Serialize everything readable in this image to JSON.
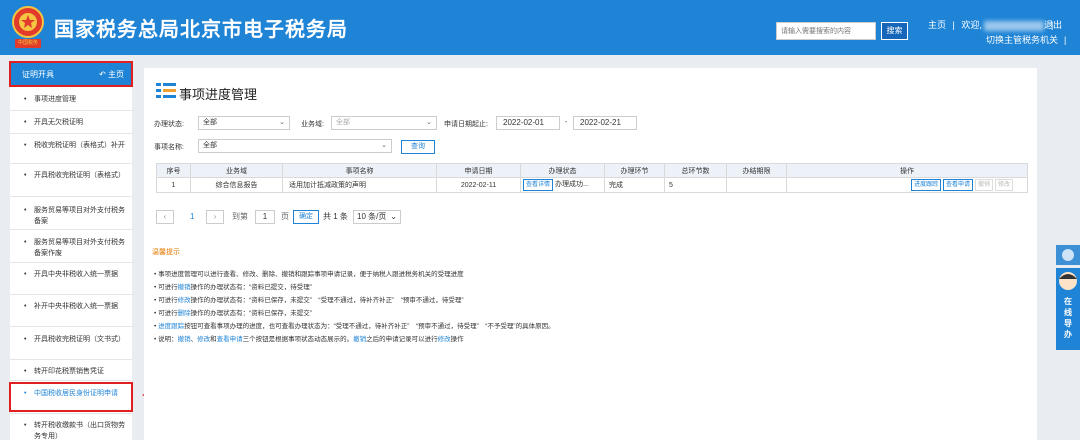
{
  "header": {
    "title": "国家税务总局北京市电子税务局",
    "search_placeholder": "请输入需要搜索的内容",
    "search_label": "搜索",
    "home": "主页",
    "welcome": "欢迎,",
    "switch_org": "切换主管税务机关",
    "logout": "退出",
    "seal_text": "中国税务"
  },
  "sidebar": {
    "head_title": "证明开具",
    "head_home": "主页",
    "items": [
      {
        "label": "事项进度管理"
      },
      {
        "label": "开具无欠税证明"
      },
      {
        "label": "税收完税证明（表格式）补开"
      },
      {
        "label": "开具税收完税证明（表格式）"
      },
      {
        "label": "服务贸易等项目对外支付税务备案"
      },
      {
        "label": "服务贸易等项目对外支付税务备案作废"
      },
      {
        "label": "开具中央非税收入统一票据"
      },
      {
        "label": "补开中央非税收入统一票据"
      },
      {
        "label": "开具税收完税证明（文书式）"
      },
      {
        "label": "转开印花税票销售凭证"
      },
      {
        "label": "中国税收居民身份证明申请"
      },
      {
        "label": "转开税收缴款书（出口货物劳务专用）"
      }
    ]
  },
  "main": {
    "title": "事项进度管理",
    "filters": {
      "status_label": "办理状态:",
      "status_value": "全部",
      "business_label": "业务域:",
      "business_value": "全部",
      "date_label": "申请日期起止:",
      "date_from": "2022-02-01",
      "date_sep": "-",
      "date_to": "2022-02-21",
      "item_label": "事项名称:",
      "item_value": "全部",
      "query": "查询"
    },
    "table": {
      "headers": [
        "序号",
        "业务域",
        "事项名称",
        "申请日期",
        "办理状态",
        "办理环节",
        "总环节数",
        "办结期限",
        "操作"
      ],
      "row": {
        "index": "1",
        "business": "综合信息报告",
        "item": "适用加计抵减政策的声明",
        "date": "2022-02-11",
        "detail_btn": "查看详情",
        "status": "办理成功...",
        "stage": "完成",
        "total": "5",
        "deadline": "",
        "ops": [
          "进度跟踪",
          "查看申请",
          "撤销",
          "修改"
        ]
      }
    },
    "pager": {
      "current": "1",
      "goto_label": "到第",
      "page_input": "1",
      "page_unit": "页",
      "confirm": "确定",
      "total": "共 1 条",
      "page_size": "10 条/页"
    },
    "tips": {
      "title": "温馨提示",
      "lines": [
        {
          "parts": [
            {
              "t": "事项进度管理可以进行查看、修改、删除、撤销和跟踪事项申请记录，便于纳税人跟进税务机关的受理进度",
              "c": ""
            }
          ]
        },
        {
          "parts": [
            {
              "t": "可进行",
              "c": ""
            },
            {
              "t": "撤销",
              "c": "blue"
            },
            {
              "t": "操作的办理状态有：“资料已提交，待受理”",
              "c": ""
            }
          ]
        },
        {
          "parts": [
            {
              "t": "可进行",
              "c": ""
            },
            {
              "t": "修改",
              "c": "blue"
            },
            {
              "t": "操作的办理状态有：“资料已保存，未提交”　“受理不通过，待补齐补正”　“预审不通过，待受理”",
              "c": ""
            }
          ]
        },
        {
          "parts": [
            {
              "t": "可进行",
              "c": ""
            },
            {
              "t": "删除",
              "c": "blue"
            },
            {
              "t": "操作的办理状态有：“资料已保存，未提交”",
              "c": ""
            }
          ]
        },
        {
          "parts": [
            {
              "t": "进度跟踪",
              "c": "blue"
            },
            {
              "t": "按钮可查看事项办理的进度，也可查看办理状态为：“受理不通过，待补齐补正”　“预审不通过，待受理”　“不予受理”的具体原因。",
              "c": ""
            }
          ]
        },
        {
          "parts": [
            {
              "t": "说明：",
              "c": ""
            },
            {
              "t": "撤销",
              "c": "blue"
            },
            {
              "t": "、",
              "c": ""
            },
            {
              "t": "修改",
              "c": "blue"
            },
            {
              "t": "和",
              "c": ""
            },
            {
              "t": "查看申请",
              "c": "blue"
            },
            {
              "t": "三个按钮是根据事项状态动态展示的。",
              "c": ""
            },
            {
              "t": "撤销",
              "c": "blue"
            },
            {
              "t": "之后的申请记录可以进行",
              "c": ""
            },
            {
              "t": "修改",
              "c": "blue"
            },
            {
              "t": "操作",
              "c": ""
            }
          ]
        }
      ]
    }
  },
  "float": {
    "label": "在线导办"
  },
  "colors": {
    "brand": "#1f84d6",
    "highlight": "#e02020",
    "tips": "#e67a00"
  }
}
